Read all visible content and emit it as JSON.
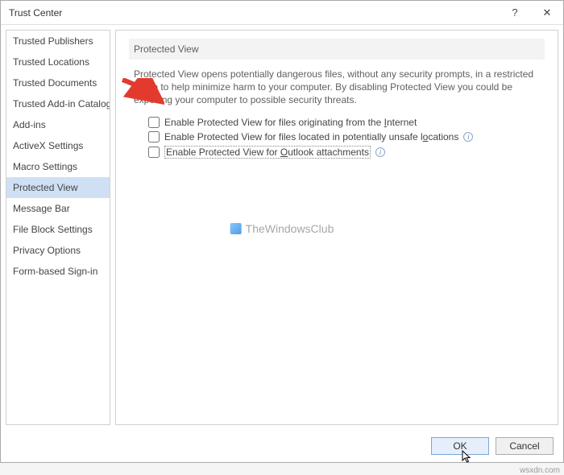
{
  "titlebar": {
    "title": "Trust Center",
    "help": "?",
    "close": "✕"
  },
  "sidebar": {
    "items": [
      {
        "label": "Trusted Publishers"
      },
      {
        "label": "Trusted Locations"
      },
      {
        "label": "Trusted Documents"
      },
      {
        "label": "Trusted Add-in Catalogs"
      },
      {
        "label": "Add-ins"
      },
      {
        "label": "ActiveX Settings"
      },
      {
        "label": "Macro Settings"
      },
      {
        "label": "Protected View"
      },
      {
        "label": "Message Bar"
      },
      {
        "label": "File Block Settings"
      },
      {
        "label": "Privacy Options"
      },
      {
        "label": "Form-based Sign-in"
      }
    ],
    "selected_index": 7
  },
  "content": {
    "header": "Protected View",
    "description": "Protected View opens potentially dangerous files, without any security prompts, in a restricted mode to help minimize harm to your computer. By disabling Protected View you could be exposing your computer to possible security threats.",
    "options": [
      {
        "pre": "Enable Protected View for files originating from the ",
        "u": "I",
        "post": "nternet",
        "info": false,
        "focus": false
      },
      {
        "pre": "Enable Protected View for files located in potentially unsafe l",
        "u": "o",
        "post": "cations",
        "info": true,
        "focus": false
      },
      {
        "pre": "Enable Protected View for ",
        "u": "O",
        "post": "utlook attachments",
        "info": true,
        "focus": true
      }
    ]
  },
  "watermark": {
    "text": "TheWindowsClub"
  },
  "footer": {
    "ok": "OK",
    "cancel": "Cancel"
  },
  "attrib": "wsxdn.com"
}
